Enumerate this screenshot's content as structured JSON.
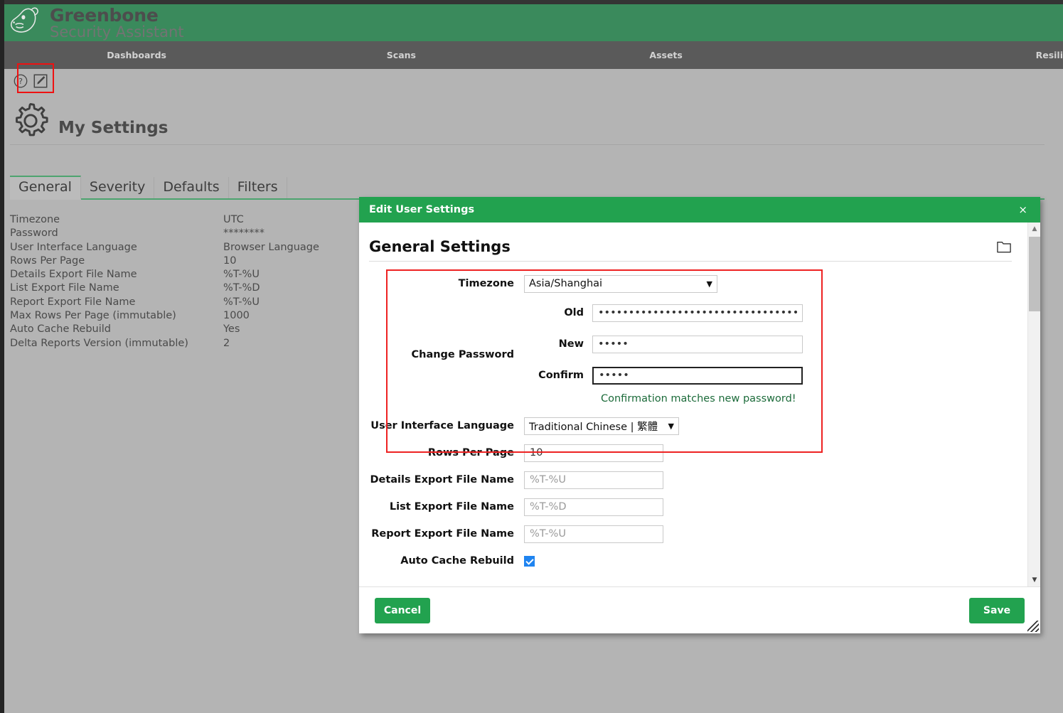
{
  "brand": {
    "title": "Greenbone",
    "subtitle": "Security Assistant",
    "logo_icon": "horse-head-logo"
  },
  "nav": {
    "items": [
      {
        "label": "Dashboards"
      },
      {
        "label": "Scans"
      },
      {
        "label": "Assets"
      },
      {
        "label": "Resili"
      }
    ]
  },
  "toolbar": {
    "help_icon": "help-circle-icon",
    "edit_icon": "edit-pencil-icon"
  },
  "page": {
    "title": "My Settings",
    "icon": "gear-icon"
  },
  "tabs": [
    {
      "label": "General",
      "active": true
    },
    {
      "label": "Severity",
      "active": false
    },
    {
      "label": "Defaults",
      "active": false
    },
    {
      "label": "Filters",
      "active": false
    }
  ],
  "settings_list": [
    {
      "label": "Timezone",
      "value": "UTC"
    },
    {
      "label": "Password",
      "value": "********"
    },
    {
      "label": "User Interface Language",
      "value": "Browser Language"
    },
    {
      "label": "Rows Per Page",
      "value": "10"
    },
    {
      "label": "Details Export File Name",
      "value": "%T-%U"
    },
    {
      "label": "List Export File Name",
      "value": "%T-%D"
    },
    {
      "label": "Report Export File Name",
      "value": "%T-%U"
    },
    {
      "label": "Max Rows Per Page (immutable)",
      "value": "1000"
    },
    {
      "label": "Auto Cache Rebuild",
      "value": "Yes"
    },
    {
      "label": "Delta Reports Version (immutable)",
      "value": "2"
    }
  ],
  "dialog": {
    "title": "Edit User Settings",
    "close_label": "×",
    "section_title": "General Settings",
    "folder_icon": "folder-icon",
    "fields": {
      "timezone": {
        "label": "Timezone",
        "value": "Asia/Shanghai",
        "caret": "▼"
      },
      "change_password": {
        "label": "Change Password",
        "old": {
          "label": "Old",
          "value": "•••••••••••••••••••••••••••••••••"
        },
        "new": {
          "label": "New",
          "value": "•••••"
        },
        "confirm": {
          "label": "Confirm",
          "value": "•••••"
        },
        "message": "Confirmation matches new password!"
      },
      "ui_language": {
        "label": "User Interface Language",
        "value": "Traditional Chinese | 繁體",
        "caret": "▼"
      },
      "rows_per_page": {
        "label": "Rows Per Page",
        "value": "10"
      },
      "details_export": {
        "label": "Details Export File Name",
        "placeholder": "%T-%U",
        "value": ""
      },
      "list_export": {
        "label": "List Export File Name",
        "placeholder": "%T-%D",
        "value": ""
      },
      "report_export": {
        "label": "Report Export File Name",
        "placeholder": "%T-%U",
        "value": ""
      },
      "auto_cache_rebuild": {
        "label": "Auto Cache Rebuild",
        "checked": true
      }
    },
    "footer": {
      "cancel_label": "Cancel",
      "save_label": "Save"
    },
    "scroll": {
      "up_arrow": "▲",
      "down_arrow": "▼"
    }
  },
  "colors": {
    "brand_green": "#3a8a5c",
    "dialog_green": "#22a24f",
    "nav_gray": "#5a5a5a",
    "page_bg": "#b4b4b4",
    "annotation_red": "#ee2222",
    "success_text": "#1c6b3a",
    "checkbox_blue": "#1f84f0"
  }
}
